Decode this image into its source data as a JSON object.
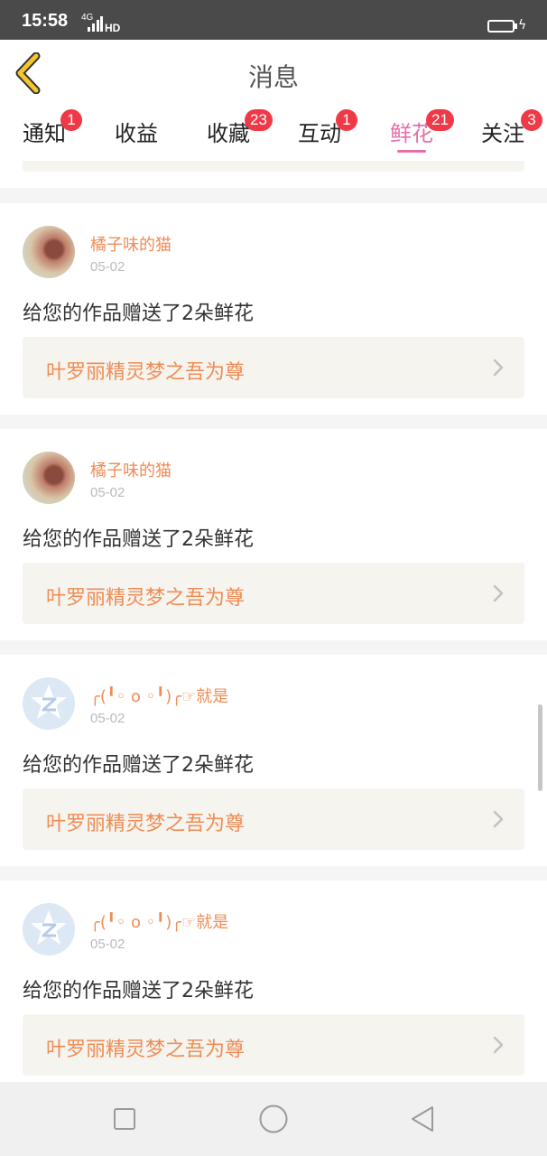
{
  "status_bar": {
    "time": "15:58",
    "network": "4G",
    "hd": "HD"
  },
  "header": {
    "title": "消息"
  },
  "tabs": [
    {
      "label": "通知",
      "badge": "1",
      "active": false
    },
    {
      "label": "收益",
      "badge": "",
      "active": false
    },
    {
      "label": "收藏",
      "badge": "23",
      "active": false
    },
    {
      "label": "互动",
      "badge": "1",
      "active": false
    },
    {
      "label": "鲜花",
      "badge": "21",
      "active": true
    },
    {
      "label": "关注",
      "badge": "3",
      "active": false
    }
  ],
  "messages": [
    {
      "username": "橘子味的猫",
      "date": "05-02",
      "text": "给您的作品赠送了2朵鲜花",
      "work": "叶罗丽精灵梦之吾为尊",
      "avatar": "photo-avatar"
    },
    {
      "username": "橘子味的猫",
      "date": "05-02",
      "text": "给您的作品赠送了2朵鲜花",
      "work": "叶罗丽精灵梦之吾为尊",
      "avatar": "photo-avatar"
    },
    {
      "username": "╭(╹◦ o ◦╹)╭☞就是",
      "date": "05-02",
      "text": "给您的作品赠送了2朵鲜花",
      "work": "叶罗丽精灵梦之吾为尊",
      "avatar": "default-avatar"
    },
    {
      "username": "╭(╹◦ o ◦╹)╭☞就是",
      "date": "05-02",
      "text": "给您的作品赠送了2朵鲜花",
      "work": "叶罗丽精灵梦之吾为尊",
      "avatar": "default-avatar"
    }
  ],
  "colors": {
    "accent_pink": "#e56fa7",
    "badge_red": "#ee3a47",
    "username_orange": "#f08c55",
    "back_arrow": "#f3c72c"
  },
  "icons": {
    "back": "back-arrow-icon",
    "chevron": "chevron-right-icon",
    "nav": [
      "recents-square-icon",
      "home-circle-icon",
      "back-triangle-icon"
    ]
  }
}
